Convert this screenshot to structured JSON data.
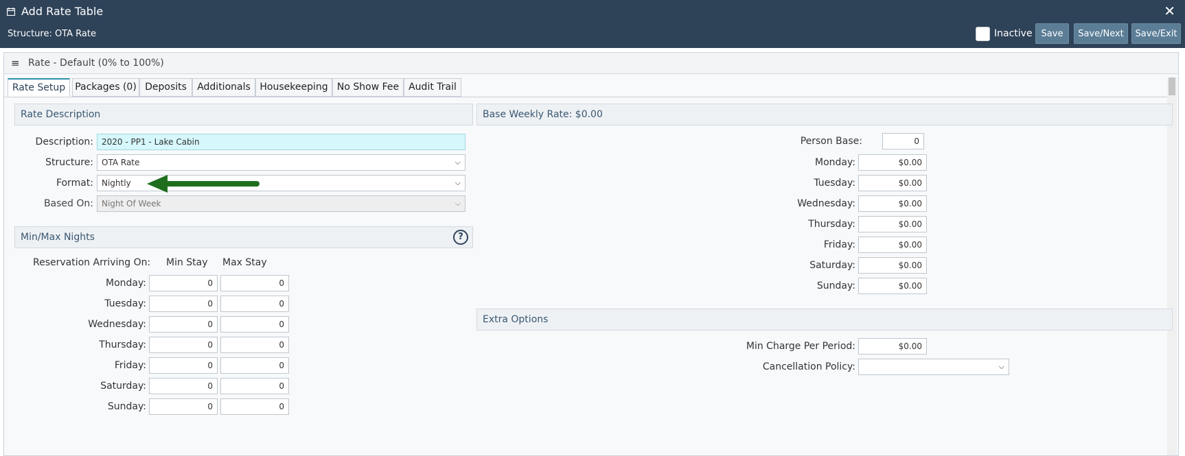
{
  "header": {
    "title": "Add Rate Table",
    "subtitle": "Structure: OTA Rate",
    "close_label": "✕",
    "inactive_label": "Inactive",
    "buttons": {
      "save": "Save",
      "save_next": "Save/Next",
      "save_exit": "Save/Exit"
    }
  },
  "frame": {
    "title": "Rate - Default (0% to 100%)",
    "menu_icon": "≡"
  },
  "tabs": [
    "Rate Setup",
    "Packages (0)",
    "Deposits",
    "Additionals",
    "Housekeeping",
    "No Show Fee",
    "Audit Trail"
  ],
  "rate_description": {
    "section_title": "Rate Description",
    "description_label": "Description:",
    "description_value": "2020 - PP1 - Lake Cabin",
    "structure_label": "Structure:",
    "structure_value": "OTA Rate",
    "format_label": "Format:",
    "format_value": "Nightly",
    "based_on_label": "Based On:",
    "based_on_value": "Night Of Week"
  },
  "min_max": {
    "section_title": "Min/Max Nights",
    "help_icon": "?",
    "arriving_label": "Reservation Arriving On:",
    "min_header": "Min Stay",
    "max_header": "Max Stay",
    "rows": [
      {
        "day": "Monday:",
        "min": "0",
        "max": "0"
      },
      {
        "day": "Tuesday:",
        "min": "0",
        "max": "0"
      },
      {
        "day": "Wednesday:",
        "min": "0",
        "max": "0"
      },
      {
        "day": "Thursday:",
        "min": "0",
        "max": "0"
      },
      {
        "day": "Friday:",
        "min": "0",
        "max": "0"
      },
      {
        "day": "Saturday:",
        "min": "0",
        "max": "0"
      },
      {
        "day": "Sunday:",
        "min": "0",
        "max": "0"
      }
    ]
  },
  "base_weekly": {
    "section_title": "Base Weekly Rate: $0.00",
    "person_base_label": "Person Base:",
    "person_base_value": "0",
    "rows": [
      {
        "day": "Monday:",
        "value": "$0.00"
      },
      {
        "day": "Tuesday:",
        "value": "$0.00"
      },
      {
        "day": "Wednesday:",
        "value": "$0.00"
      },
      {
        "day": "Thursday:",
        "value": "$0.00"
      },
      {
        "day": "Friday:",
        "value": "$0.00"
      },
      {
        "day": "Saturday:",
        "value": "$0.00"
      },
      {
        "day": "Sunday:",
        "value": "$0.00"
      }
    ]
  },
  "extra_options": {
    "section_title": "Extra Options",
    "min_charge_label": "Min Charge Per Period:",
    "min_charge_value": "$0.00",
    "cancellation_label": "Cancellation Policy:",
    "cancellation_value": ""
  },
  "colors": {
    "header_bg": "#2e4258",
    "button_bg": "#5b7d96",
    "arrow": "#1e6e1e",
    "active_tab": "#2e8fa8"
  }
}
